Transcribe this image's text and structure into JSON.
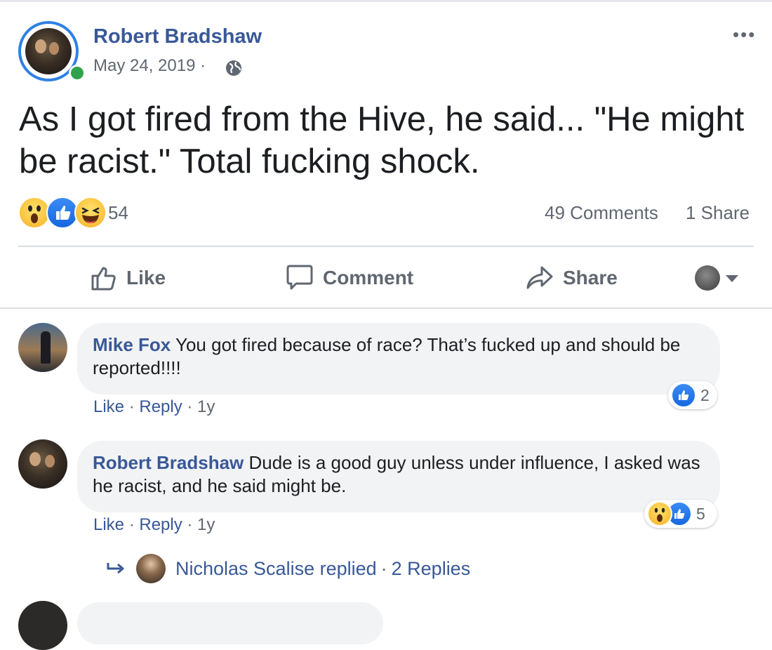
{
  "post": {
    "author": "Robert Bradshaw",
    "date": "May 24, 2019",
    "date_sep": "·",
    "more": "•••",
    "text": "As I got fired from the Hive, he said... \"He might be racist.\" Total fucking shock.",
    "reaction_count": "54",
    "comments_count": "49 Comments",
    "share_count": "1 Share",
    "reactions": [
      "wow",
      "like",
      "haha"
    ]
  },
  "actions": {
    "like": "Like",
    "comment": "Comment",
    "share": "Share"
  },
  "comments": [
    {
      "name": "Mike Fox",
      "text": " You got fired because of race? That’s fucked up and should be reported!!!!",
      "like": "Like",
      "reply": "Reply",
      "time": "1y",
      "reaction_count": "2"
    },
    {
      "name": "Robert Bradshaw",
      "text": " Dude is a good guy unless under influence, I asked was he racist, and he said might be.",
      "like": "Like",
      "reply": "Reply",
      "time": "1y",
      "reaction_count": "5",
      "replies_summary": "Nicholas Scalise replied",
      "replies_count": "2 Replies"
    }
  ],
  "colors": {
    "link": "#385898",
    "accent": "#1877f2",
    "online": "#31a24c",
    "muted": "#606770",
    "bubble": "#f2f3f5"
  }
}
